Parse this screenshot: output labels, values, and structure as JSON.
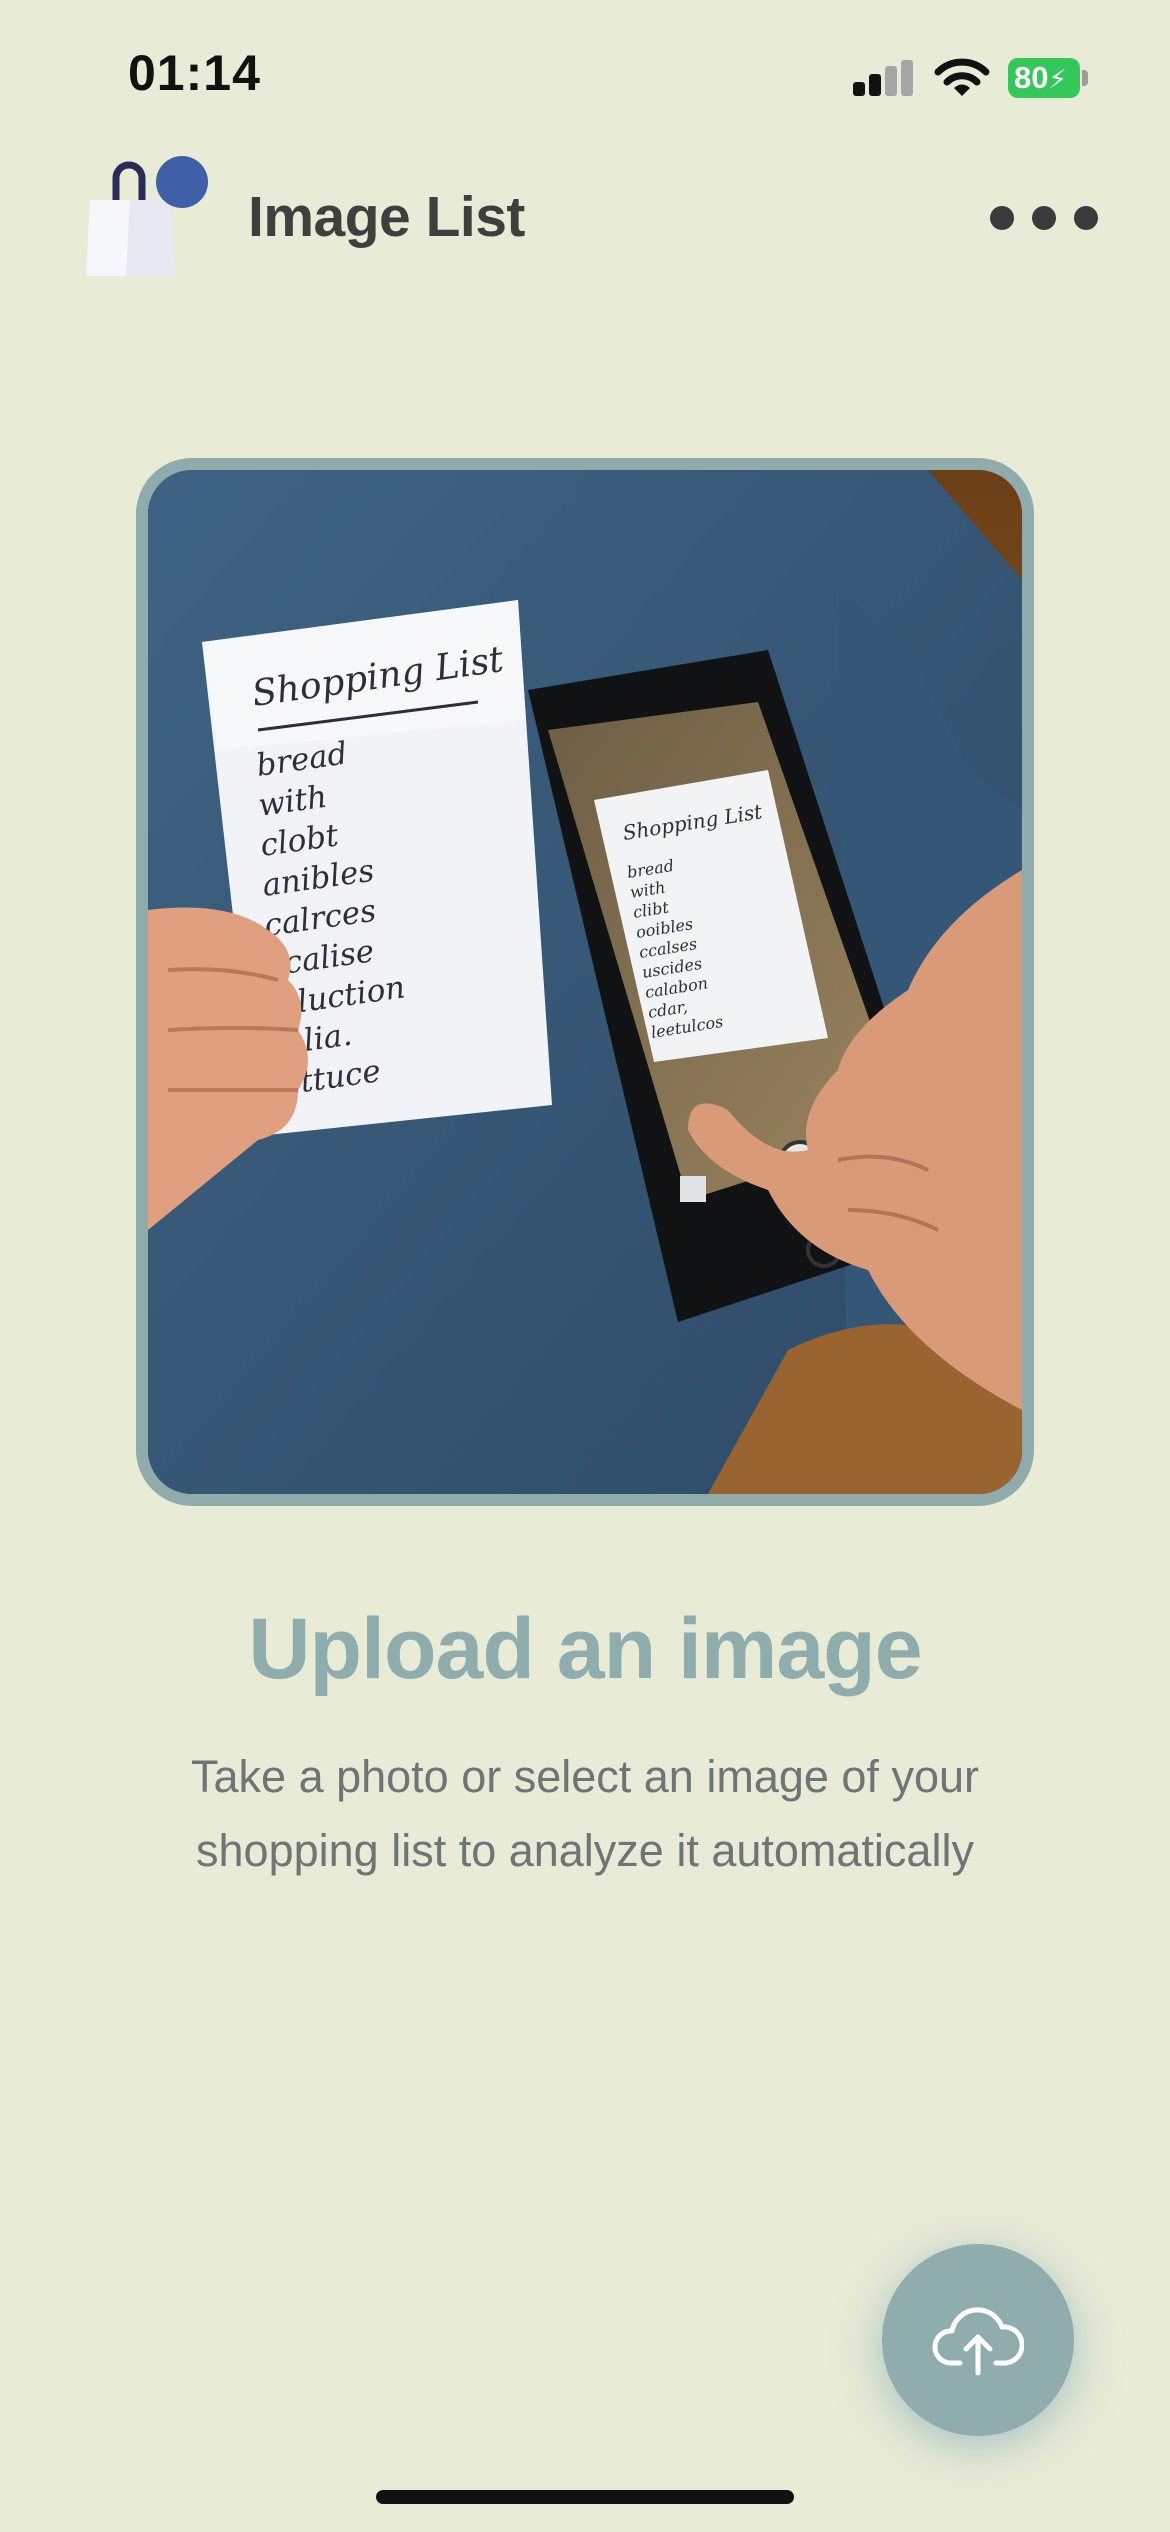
{
  "status_bar": {
    "time": "01:14",
    "battery_level": "80",
    "battery_color": "#34c759"
  },
  "header": {
    "title": "Image List",
    "logo_icon": "shopping-bag-icon",
    "menu_icon": "more-dots-icon"
  },
  "hero": {
    "image_kind": "photo",
    "list_title": "Shopping List",
    "left_items": [
      "bread",
      "with",
      "clobt",
      "anibles",
      "calrces",
      "ecalise",
      "clluction",
      "sblia.",
      "lettuce"
    ],
    "phone_items": [
      "bread",
      "with",
      "clibt",
      "ooibles",
      "ccalses",
      "uscides",
      "calabon",
      "cdar,",
      "leetulcos"
    ]
  },
  "empty_state": {
    "title": "Upload an image",
    "description": "Take a photo or select an image of your shopping list to analyze it automatically"
  },
  "fab": {
    "icon": "cloud-upload-icon",
    "color": "#90adae"
  },
  "colors": {
    "background": "#e8ebd5",
    "accent": "#90adae",
    "title_text": "#3f3f3f",
    "body_text": "#6e7579"
  }
}
